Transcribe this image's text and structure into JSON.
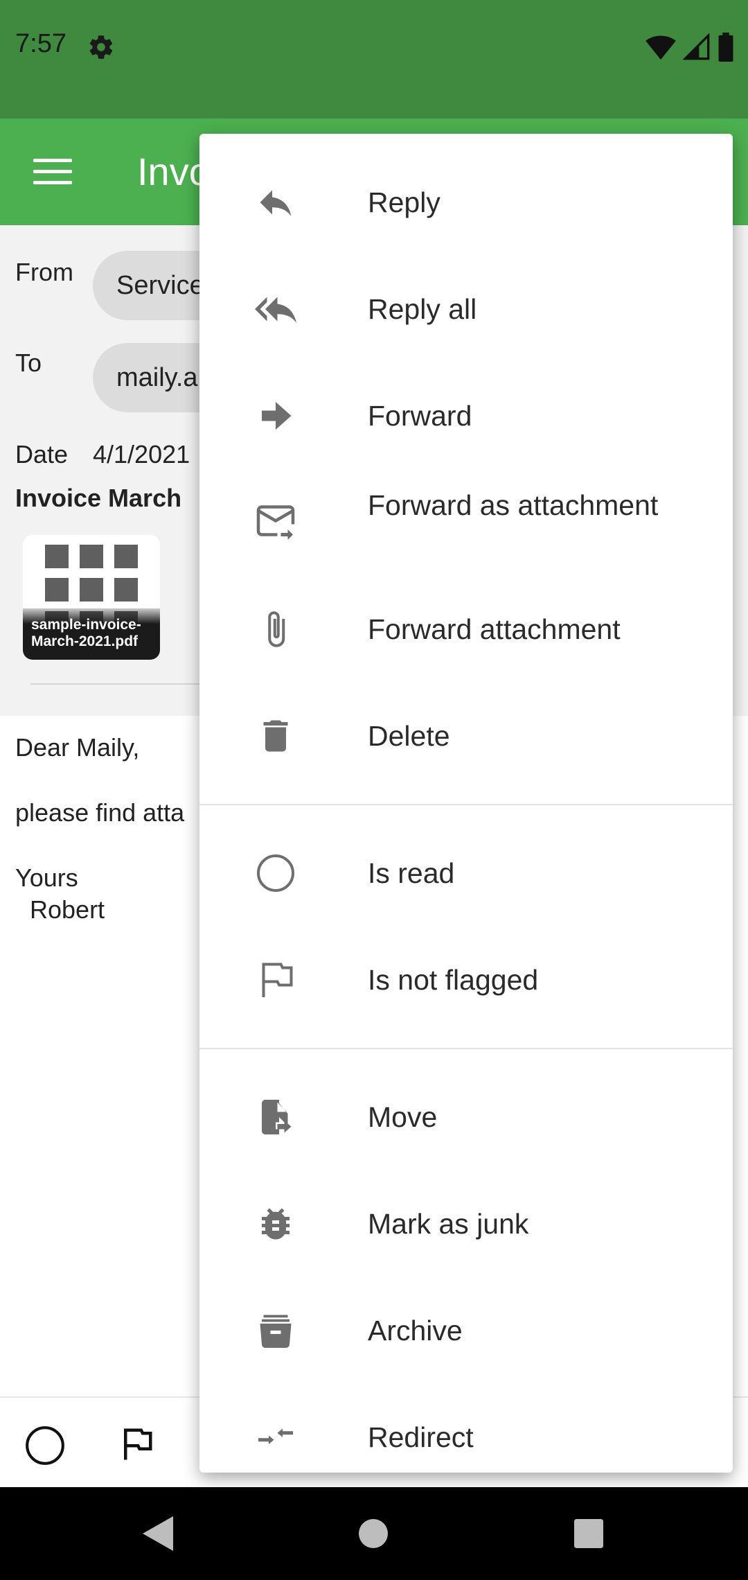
{
  "status_bar": {
    "time": "7:57"
  },
  "app_bar": {
    "title": "Invoice March"
  },
  "message": {
    "from_label": "From",
    "from_value": "Service",
    "to_label": "To",
    "to_value": "maily.a",
    "date_label": "Date",
    "date_value": "4/1/2021",
    "subject": "Invoice March",
    "attachment": {
      "filename": "sample-invoice-March-2021.pdf"
    },
    "body": {
      "greeting": "Dear Maily,",
      "line1": "please find atta",
      "closing": "Yours",
      "signature": "Robert"
    }
  },
  "menu": {
    "items": [
      {
        "label": "Reply",
        "icon": "reply-icon"
      },
      {
        "label": "Reply all",
        "icon": "reply-all-icon"
      },
      {
        "label": "Forward",
        "icon": "forward-icon"
      },
      {
        "label": "Forward as attachment",
        "icon": "mail-forward-icon"
      },
      {
        "label": "Forward attachment",
        "icon": "paperclip-icon"
      },
      {
        "label": "Delete",
        "icon": "trash-icon"
      },
      {
        "label": "Is read",
        "icon": "circle-icon"
      },
      {
        "label": "Is not flagged",
        "icon": "flag-outline-icon"
      },
      {
        "label": "Move",
        "icon": "file-move-icon"
      },
      {
        "label": "Mark as junk",
        "icon": "bug-icon"
      },
      {
        "label": "Archive",
        "icon": "archive-icon"
      },
      {
        "label": "Redirect",
        "icon": "redirect-icon"
      }
    ]
  },
  "bottom_bar": {
    "icons": [
      "circle-icon",
      "flag-outline-icon"
    ]
  },
  "nav_bar": {
    "icons": [
      "back-icon",
      "home-icon",
      "recents-icon"
    ]
  },
  "colors": {
    "status_bar": "#3f8a3f",
    "app_bar": "#4caf50",
    "icon_gray": "#6e6e6e"
  }
}
